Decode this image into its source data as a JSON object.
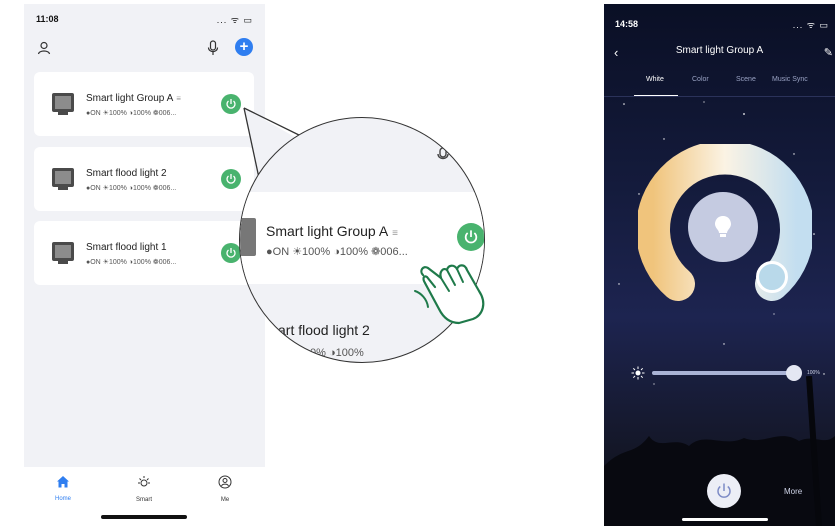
{
  "left_phone": {
    "status_time": "11:08",
    "status_icons": "... ᯤ ▭",
    "devices": [
      {
        "name": "Smart light Group A",
        "meta": "●ON ☀100% ◑100% ❁006...",
        "is_group": true
      },
      {
        "name": "Smart flood light 2",
        "meta": "●ON ☀100% ◑100% ❁006...",
        "is_group": false
      },
      {
        "name": "Smart flood light 1",
        "meta": "●ON ☀100% ◑100% ❁006...",
        "is_group": false
      }
    ],
    "tabs": [
      {
        "label": "Home",
        "active": true
      },
      {
        "label": "Smart",
        "active": false
      },
      {
        "label": "Me",
        "active": false
      }
    ],
    "colors": {
      "accent": "#2f7ef0",
      "power": "#49b36e",
      "background": "#f1f2f6"
    }
  },
  "magnifier": {
    "name": "Smart light Group A",
    "meta": "●ON ☀100% ◑100% ❁006...",
    "next_name": "art flood light 2",
    "next_meta": "0% ◑100%"
  },
  "right_phone": {
    "status_time": "14:58",
    "status_icons": "... ᯤ ▭",
    "title": "Smart light Group A",
    "tabs": [
      {
        "label": "White",
        "active": true
      },
      {
        "label": "Color",
        "active": false
      },
      {
        "label": "Scene",
        "active": false
      },
      {
        "label": "Music Sync",
        "active": false
      }
    ],
    "brightness_value": "100%",
    "brightness_fraction": 1.0,
    "more_label": "More",
    "icons": [
      "back-icon",
      "edit-icon",
      "bulb-icon",
      "sun-icon",
      "power-icon"
    ]
  }
}
